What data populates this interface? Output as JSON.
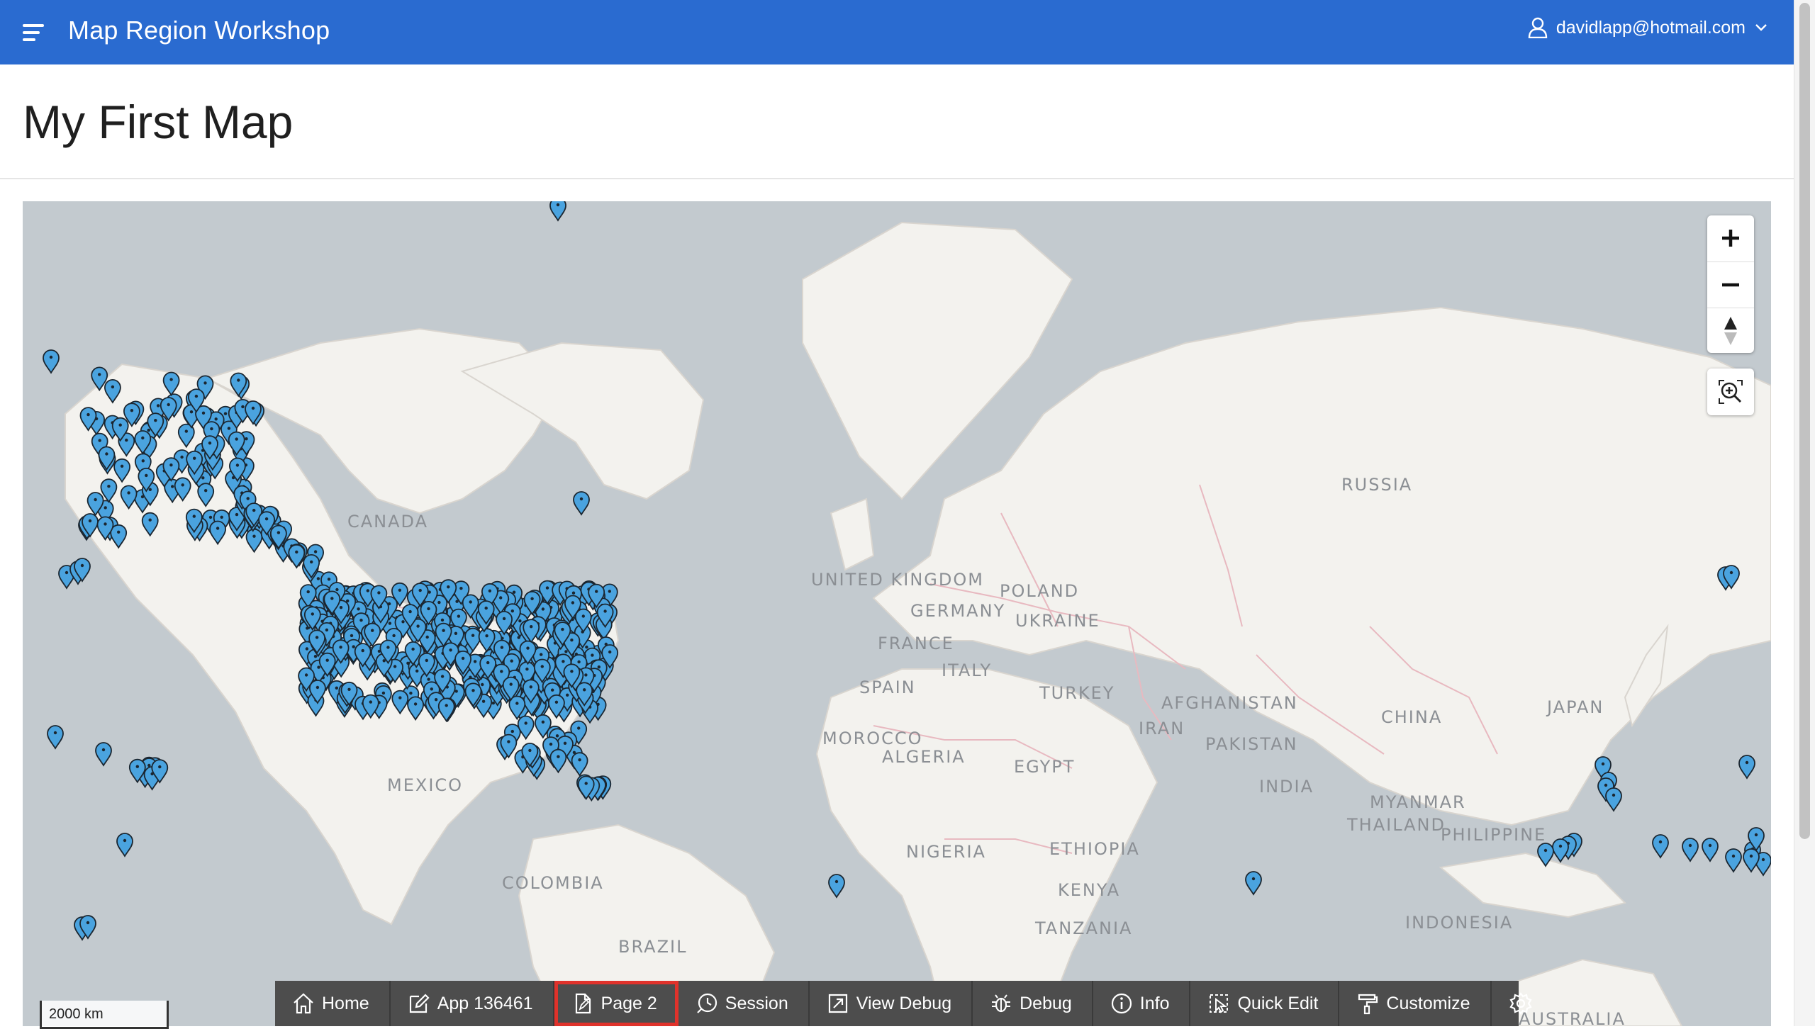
{
  "header": {
    "app_title": "Map Region Workshop",
    "user_email": "davidlapp@hotmail.com",
    "color": "#2a6bd0"
  },
  "page": {
    "title": "My First Map"
  },
  "map": {
    "labels": {
      "canada": "CANADA",
      "russia": "RUSSIA",
      "united_kingdom": "UNITED KINGDOM",
      "germany": "GERMANY",
      "poland": "POLAND",
      "ukraine": "UKRAINE",
      "france": "FRANCE",
      "italy": "ITALY",
      "spain": "SPAIN",
      "turkey": "TURKEY",
      "afghanistan": "AFGHANISTAN",
      "iran": "IRAN",
      "pakistan": "PAKISTAN",
      "china": "CHINA",
      "japan": "JAPAN",
      "morocco": "MOROCCO",
      "algeria": "ALGERIA",
      "egypt": "EGYPT",
      "india": "INDIA",
      "myanmar": "MYANMAR",
      "thailand": "THAILAND",
      "philippines": "PHILIPPINE",
      "mexico": "MEXICO",
      "nigeria": "NIGERIA",
      "ethiopia": "ETHIOPIA",
      "kenya": "KENYA",
      "colombia": "COLOMBIA",
      "tanzania": "TANZANIA",
      "indonesia": "INDONESIA",
      "brazil": "BRAZIL",
      "australia": "AUSTRALIA"
    },
    "scale": "2000 km",
    "marker_color": "#4aa3df",
    "controls": [
      "plus-icon",
      "minus-icon",
      "compass-icon",
      "zoom-to-data-icon"
    ]
  },
  "devbar": {
    "items": [
      {
        "label": "Home",
        "icon": "home-icon"
      },
      {
        "label": "App 136461",
        "icon": "edit-icon"
      },
      {
        "label": "Page 2",
        "icon": "page-icon",
        "active": true
      },
      {
        "label": "Session",
        "icon": "session-icon"
      },
      {
        "label": "View Debug",
        "icon": "view-debug-icon"
      },
      {
        "label": "Debug",
        "icon": "bug-icon"
      },
      {
        "label": "Info",
        "icon": "info-icon"
      },
      {
        "label": "Quick Edit",
        "icon": "quick-edit-icon"
      },
      {
        "label": "Customize",
        "icon": "paint-roller-icon"
      },
      {
        "label": "",
        "icon": "gear-icon"
      }
    ],
    "highlight_color": "#e0322b"
  }
}
